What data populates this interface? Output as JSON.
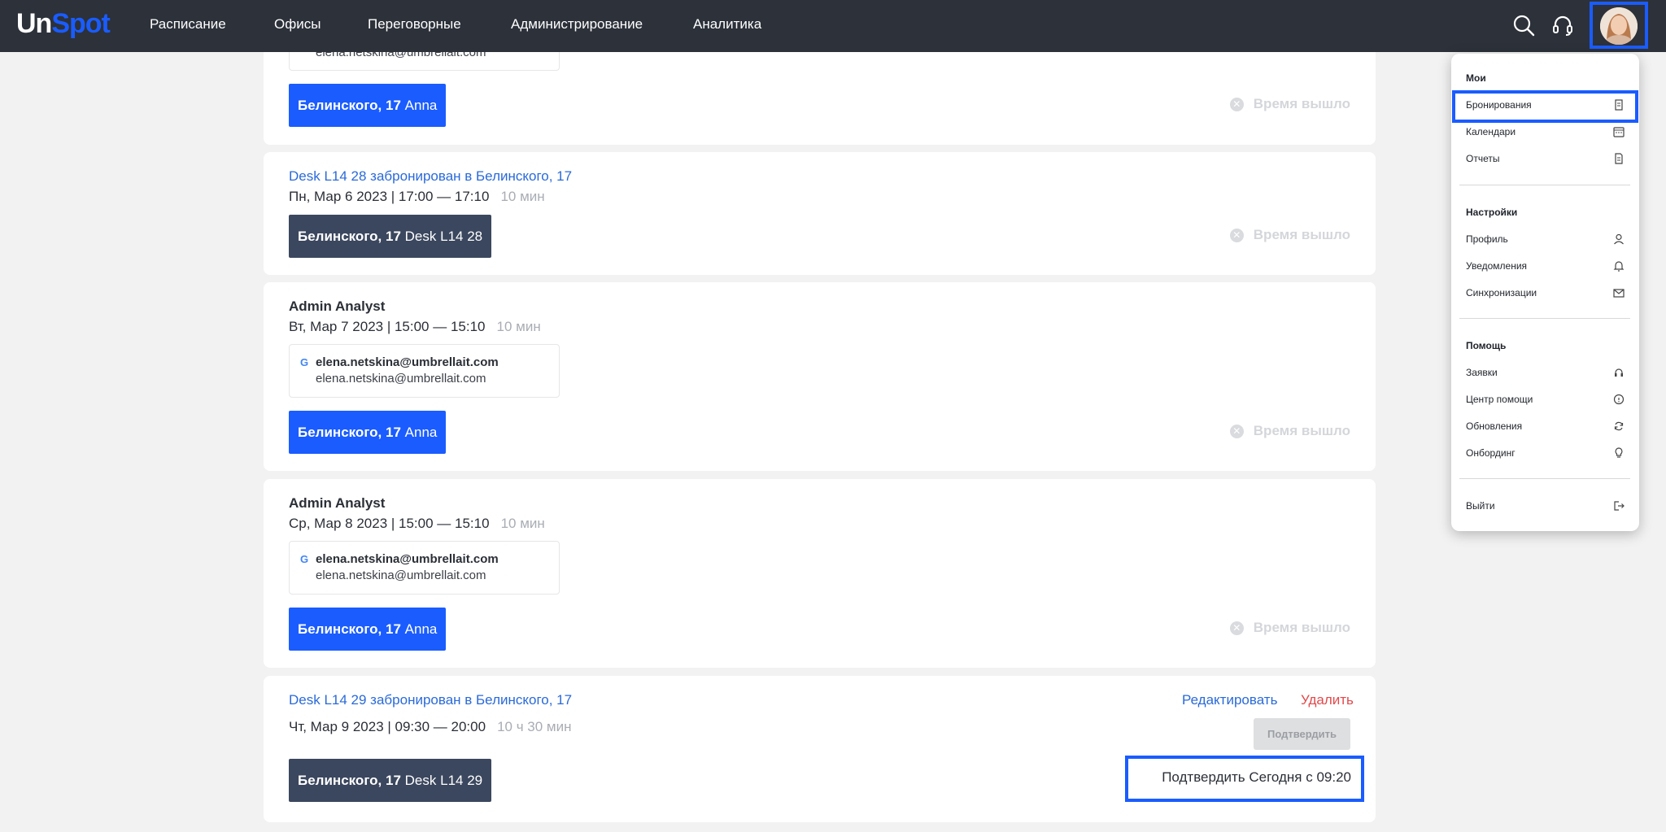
{
  "app": {
    "logo_un": "Un",
    "logo_spot": "Spot"
  },
  "nav": {
    "items": [
      "Расписание",
      "Офисы",
      "Переговорные",
      "Администрирование",
      "Аналитика"
    ]
  },
  "header_icons": [
    "search-icon",
    "headset-icon",
    "avatar"
  ],
  "feed": {
    "partial_card": {
      "email_clipped": "elena.netskina@umbrellait.com",
      "tag_bold": "Белинского, 17",
      "tag_rest": "Anna",
      "status": "Время вышло"
    },
    "cards": [
      {
        "title": "Desk L14 28 забронирован в Белинского, 17",
        "date": "Пн, Мар 6 2023 | 17:00 — 17:10",
        "duration": "10 мин",
        "tag_bold": "Белинского, 17",
        "tag_rest": "Desk L14 28",
        "status": "Время вышло"
      },
      {
        "title": "Admin Analyst",
        "date": "Вт, Мар 7 2023 | 15:00 — 15:10",
        "duration": "10 мин",
        "guest_main": "elena.netskina@umbrellait.com",
        "guest_sub": "elena.netskina@umbrellait.com",
        "tag_bold": "Белинского, 17",
        "tag_rest": "Anna",
        "status": "Время вышло"
      },
      {
        "title": "Admin Analyst",
        "date": "Ср, Мар 8 2023 | 15:00 — 15:10",
        "duration": "10 мин",
        "guest_main": "elena.netskina@umbrellait.com",
        "guest_sub": "elena.netskina@umbrellait.com",
        "tag_bold": "Белинского, 17",
        "tag_rest": "Anna",
        "status": "Время вышло"
      },
      {
        "title": "Desk L14 29 забронирован в Белинского, 17",
        "date": "Чт, Мар 9 2023 | 09:30 — 20:00",
        "duration": "10 ч 30 мин",
        "tag_bold": "Белинского, 17",
        "tag_rest": "Desk L14 29",
        "edit_label": "Редактировать",
        "delete_label": "Удалить",
        "confirm_label": "Подтвердить",
        "confirm_hint": "Подтвердить Сегодня с 09:20"
      }
    ]
  },
  "menu": {
    "section_my": "Мои",
    "my_items": [
      {
        "label": "Бронирования",
        "icon": "bookings-icon",
        "active": true
      },
      {
        "label": "Календари",
        "icon": "calendar-icon"
      },
      {
        "label": "Отчеты",
        "icon": "report-icon"
      }
    ],
    "section_settings": "Настройки",
    "settings_items": [
      {
        "label": "Профиль",
        "icon": "user-icon"
      },
      {
        "label": "Уведомления",
        "icon": "bell-icon"
      },
      {
        "label": "Синхронизации",
        "icon": "mail-icon"
      }
    ],
    "section_help": "Помощь",
    "help_items": [
      {
        "label": "Заявки",
        "icon": "support-icon"
      },
      {
        "label": "Центр помощи",
        "icon": "chat-icon"
      },
      {
        "label": "Обновления",
        "icon": "refresh-icon"
      },
      {
        "label": "Онбординг",
        "icon": "lightbulb-icon"
      }
    ],
    "logout": {
      "label": "Выйти",
      "icon": "logout-icon"
    }
  },
  "colors": {
    "topbar": "#2c313a",
    "accent": "#1a5cff",
    "link": "#2a6ad9",
    "danger": "#e2494b",
    "tag_dark": "#3b475e"
  }
}
